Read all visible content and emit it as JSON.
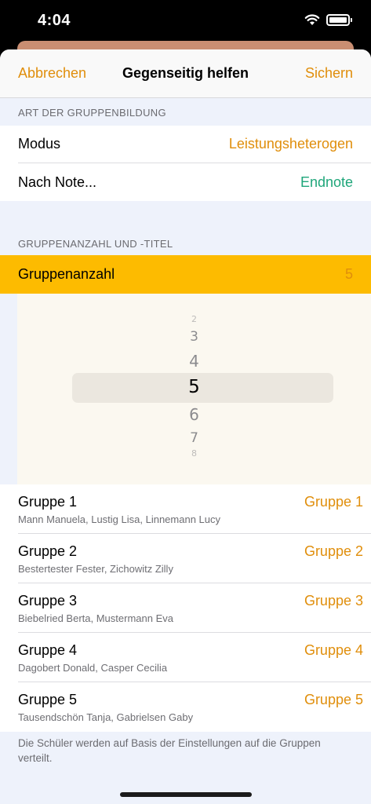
{
  "status": {
    "time": "4:04"
  },
  "nav": {
    "cancel": "Abbrechen",
    "title": "Gegenseitig helfen",
    "save": "Sichern"
  },
  "section1": {
    "header": "ART DER GRUPPENBILDUNG",
    "rows": [
      {
        "label": "Modus",
        "value": "Leistungsheterogen",
        "color": "#e08e0b"
      },
      {
        "label": "Nach Note...",
        "value": "Endnote",
        "color": "#1fa67a"
      }
    ]
  },
  "section2": {
    "header": "GRUPPENANZAHL UND -TITEL",
    "count_label": "Gruppenanzahl",
    "count_value": "5"
  },
  "picker": {
    "items": [
      "2",
      "3",
      "4",
      "5",
      "6",
      "7",
      "8"
    ],
    "selected": "5"
  },
  "groups": [
    {
      "name": "Gruppe 1",
      "members": "Mann Manuela, Lustig Lisa, Linnemann Lucy",
      "title": "Gruppe 1"
    },
    {
      "name": "Gruppe 2",
      "members": "Bestertester Fester, Zichowitz Zilly",
      "title": "Gruppe 2"
    },
    {
      "name": "Gruppe 3",
      "members": "Biebelried Berta, Mustermann Eva",
      "title": "Gruppe 3"
    },
    {
      "name": "Gruppe 4",
      "members": "Dagobert Donald, Casper Cecilia",
      "title": "Gruppe 4"
    },
    {
      "name": "Gruppe 5",
      "members": "Tausendschön Tanja, Gabrielsen Gaby",
      "title": "Gruppe 5"
    }
  ],
  "footer": "Die Schüler werden auf Basis der Einstellungen auf die Gruppen verteilt."
}
